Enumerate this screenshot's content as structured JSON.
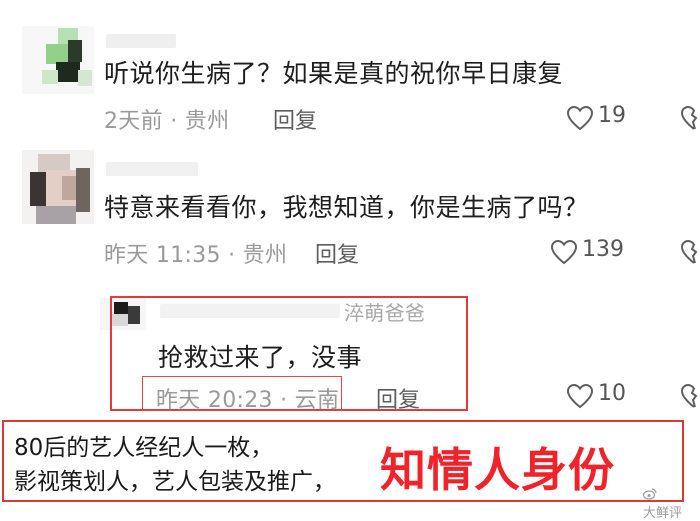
{
  "comments": [
    {
      "text": "听说你生病了？如果是真的祝你早日康复",
      "meta": "2天前 · 贵州",
      "reply_label": "回复",
      "likes": "19"
    },
    {
      "text": "特意来看看你，我想知道，你是生病了吗？",
      "meta": "昨天 11:35 · 贵州",
      "reply_label": "回复",
      "likes": "139"
    }
  ],
  "reply_comment": {
    "username": "淬萌爸爸",
    "text": "抢救过来了，没事",
    "meta": "昨天 20:23 · 云南",
    "reply_label": "回复",
    "likes": "10"
  },
  "bottom_card": {
    "line1": "80后的艺人经纪人一枚，",
    "line2": "影视策划人，艺人包装及推广，",
    "overlay_title": "知情人身份"
  },
  "watermark": "大鲜评",
  "colors": {
    "highlight_red": "#e33a3a",
    "overlay_red": "#f0222a",
    "meta_gray": "#9a9a9a"
  },
  "icons": {
    "like": "heart-outline-icon",
    "dislike": "broken-heart-icon"
  }
}
